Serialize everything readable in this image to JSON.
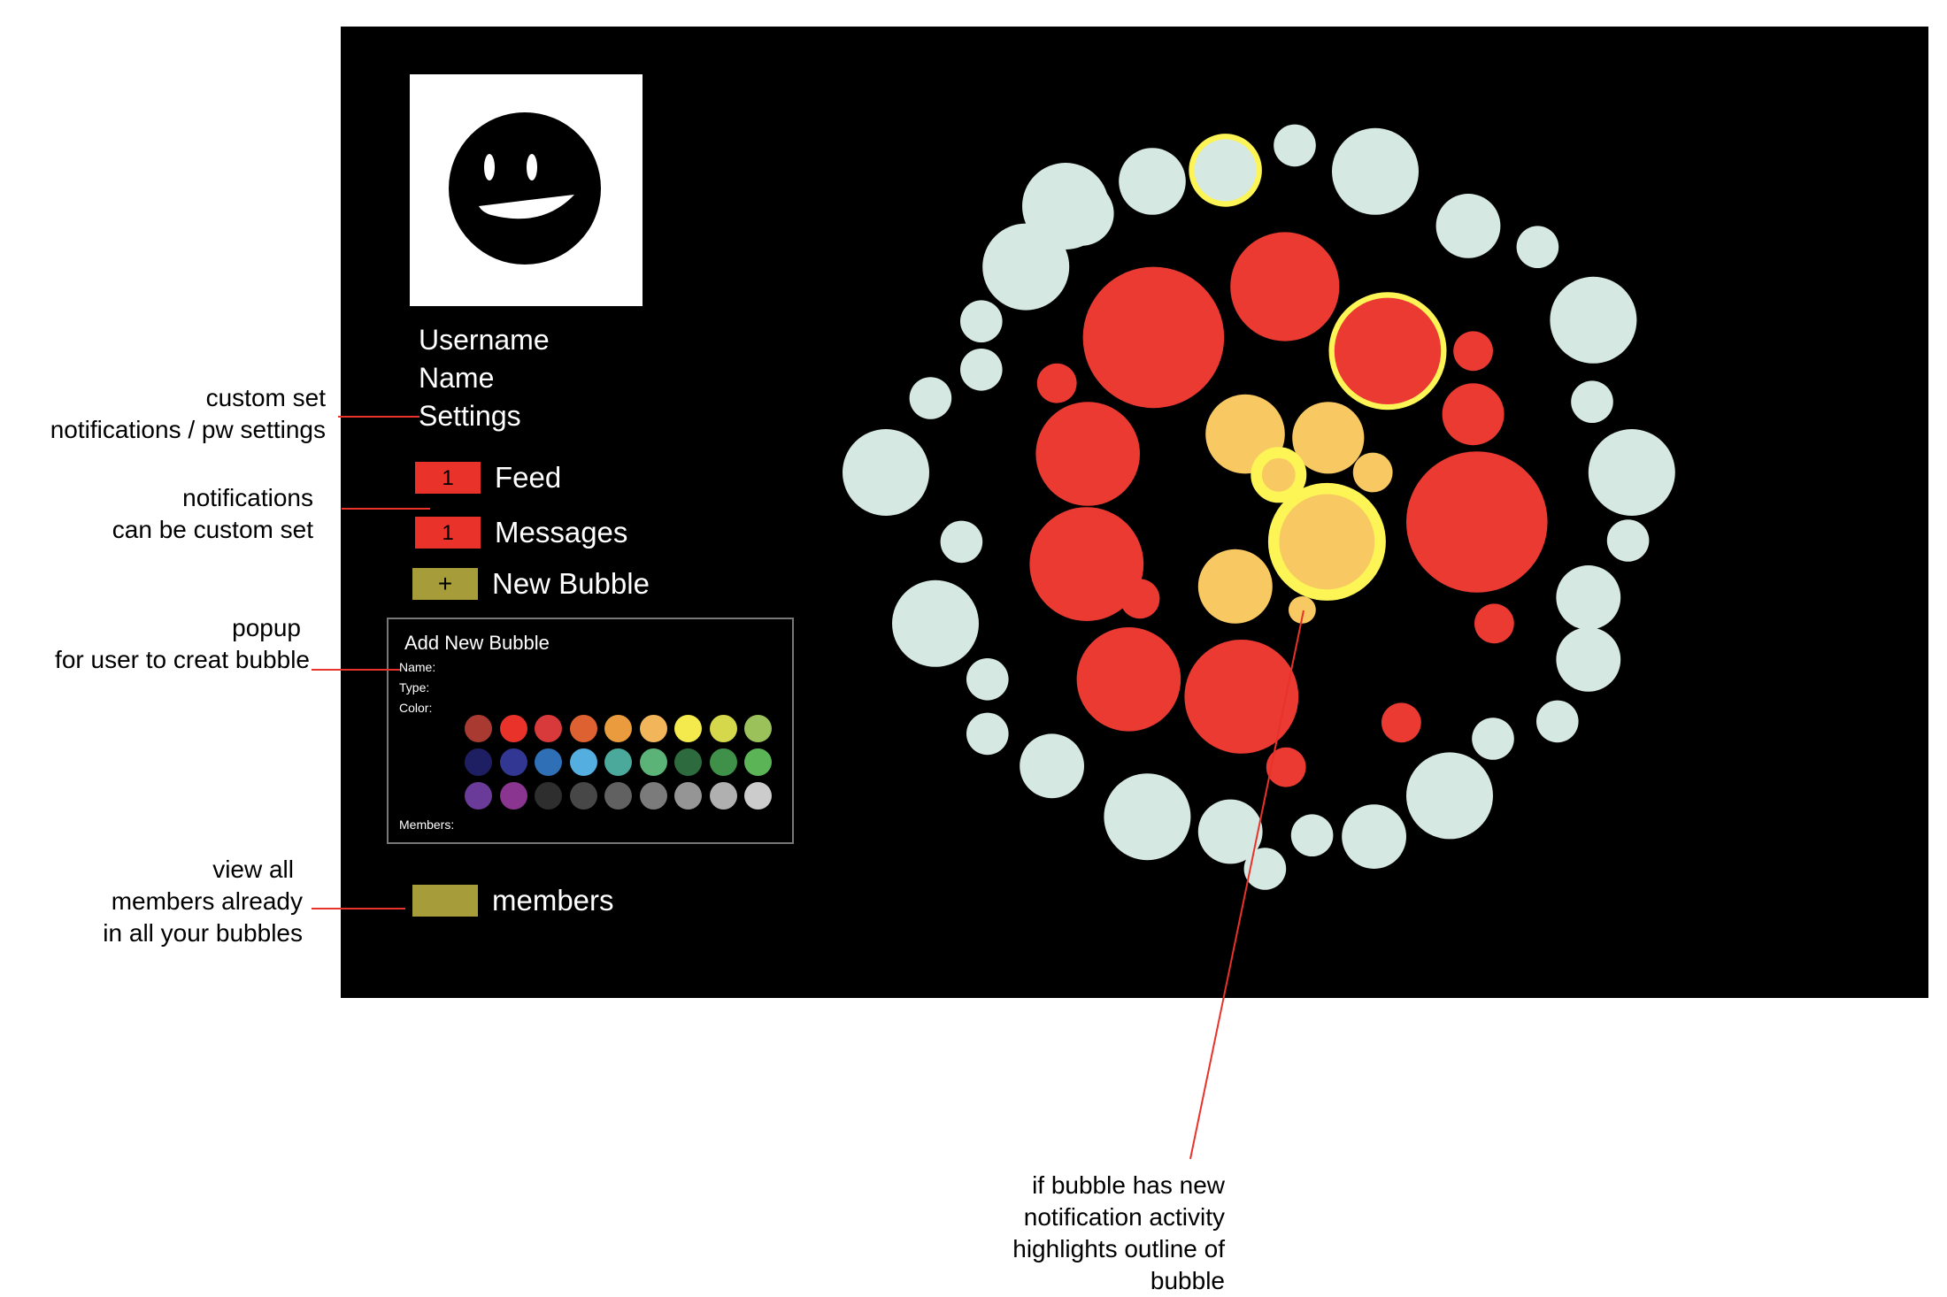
{
  "profile": {
    "username_label": "Username",
    "name_label": "Name",
    "settings_label": "Settings"
  },
  "nav": {
    "feed": {
      "badge": "1",
      "label": "Feed"
    },
    "messages": {
      "badge": "1",
      "label": "Messages"
    },
    "new_bubble": {
      "icon": "+",
      "label": "New Bubble"
    },
    "members": {
      "label": "members"
    }
  },
  "popup": {
    "title": "Add New Bubble",
    "name_label": "Name:",
    "type_label": "Type:",
    "color_label": "Color:",
    "members_label": "Members:",
    "color_swatches": [
      [
        "#a83a32",
        "#e8322a",
        "#d8393a",
        "#de6131",
        "#ea9b3e",
        "#f2b55a",
        "#f4e94d",
        "#d5d84a",
        "#9bc15a"
      ],
      [
        "#1e1f62",
        "#313793",
        "#2e6fb5",
        "#55aee0",
        "#4aa99a",
        "#5cb377",
        "#2d6a3e",
        "#3f9149",
        "#5bb557"
      ],
      [
        "#6a3b98",
        "#8a3590",
        "#2e2e2e",
        "#474747",
        "#616161",
        "#7b7b7b",
        "#959595",
        "#b0b0b0",
        "#cccccc"
      ]
    ]
  },
  "colors": {
    "screen_bg": "#000000",
    "notification_red": "#e8322a",
    "olive": "#a69c3a",
    "bubble_red": "#ea3a32",
    "bubble_orange": "#f8c862",
    "bubble_pale": "#d5e8e1",
    "highlight_yellow": "#fdf456",
    "annotation_line": "#e8322a"
  },
  "annotations": {
    "settings": [
      "custom set",
      "notifications / pw settings"
    ],
    "notifications": [
      "notifications",
      "can be custom set"
    ],
    "popup": [
      "popup",
      "for user to creat bubble"
    ],
    "members": [
      "view all",
      "members already",
      "in all your bubbles"
    ],
    "highlight": [
      "if bubble has new",
      "notification activity",
      "highlights outline of",
      "bubble"
    ]
  },
  "bubble_chart": {
    "outer_ring": [
      {
        "color": "pale"
      },
      {
        "color": "pale"
      },
      {
        "color": "pale",
        "highlighted": true
      },
      {
        "color": "pale"
      },
      {
        "color": "pale"
      },
      {
        "color": "pale"
      },
      {
        "color": "pale"
      },
      {
        "color": "pale"
      },
      {
        "color": "pale"
      },
      {
        "color": "pale"
      },
      {
        "color": "pale"
      },
      {
        "color": "pale"
      },
      {
        "color": "pale"
      },
      {
        "color": "pale"
      },
      {
        "color": "pale"
      },
      {
        "color": "pale"
      },
      {
        "color": "pale"
      },
      {
        "color": "pale"
      },
      {
        "color": "pale"
      },
      {
        "color": "pale"
      },
      {
        "color": "pale"
      },
      {
        "color": "pale"
      },
      {
        "color": "pale"
      },
      {
        "color": "pale"
      },
      {
        "color": "pale"
      },
      {
        "color": "pale"
      },
      {
        "color": "pale"
      },
      {
        "color": "pale"
      },
      {
        "color": "pale"
      },
      {
        "color": "pale"
      },
      {
        "color": "pale"
      },
      {
        "color": "pale"
      },
      {
        "color": "pale"
      }
    ],
    "middle_ring": [
      {
        "color": "red"
      },
      {
        "color": "red"
      },
      {
        "color": "red",
        "highlighted": true
      },
      {
        "color": "red"
      },
      {
        "color": "red"
      },
      {
        "color": "red"
      },
      {
        "color": "red"
      },
      {
        "color": "red"
      },
      {
        "color": "red"
      },
      {
        "color": "red"
      },
      {
        "color": "red"
      },
      {
        "color": "red"
      },
      {
        "color": "red"
      },
      {
        "color": "red"
      },
      {
        "color": "red"
      },
      {
        "color": "red"
      }
    ],
    "inner_cluster": [
      {
        "color": "orange"
      },
      {
        "color": "orange"
      },
      {
        "color": "orange",
        "highlighted": true
      },
      {
        "color": "orange"
      },
      {
        "color": "orange",
        "highlighted": true
      },
      {
        "color": "orange"
      },
      {
        "color": "orange"
      },
      {
        "color": "orange"
      }
    ]
  }
}
